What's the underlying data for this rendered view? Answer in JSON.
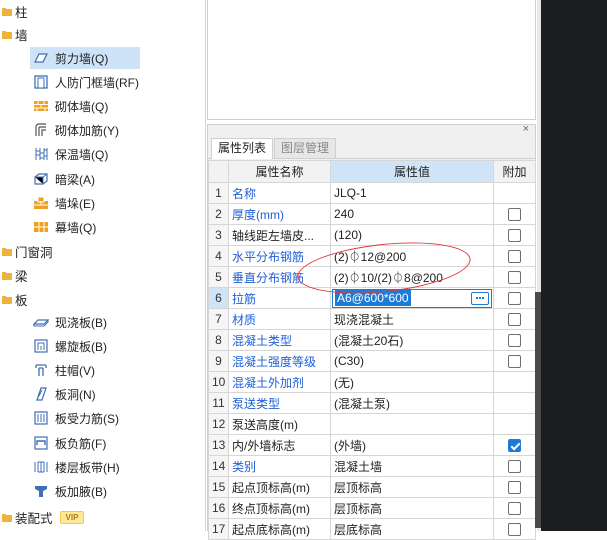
{
  "tree": {
    "categories": [
      {
        "label": "柱",
        "icon": "column-icon"
      },
      {
        "label": "墙",
        "icon": "wall-icon"
      },
      {
        "label": "门窗洞",
        "icon": "door-window-icon"
      },
      {
        "label": "梁",
        "icon": "beam-icon"
      },
      {
        "label": "板",
        "icon": "slab-icon"
      },
      {
        "label": "装配式",
        "icon": "prefab-icon",
        "badge": "VIP"
      }
    ],
    "wall_items": [
      {
        "label": "剪力墙(Q)",
        "icon": "shear-wall-icon",
        "selected": true
      },
      {
        "label": "人防门框墙(RF)",
        "icon": "civil-defense-door-wall-icon"
      },
      {
        "label": "砌体墙(Q)",
        "icon": "masonry-wall-icon"
      },
      {
        "label": "砌体加筋(Y)",
        "icon": "masonry-rebar-icon"
      },
      {
        "label": "保温墙(Q)",
        "icon": "insulation-wall-icon"
      },
      {
        "label": "暗梁(A)",
        "icon": "hidden-beam-icon"
      },
      {
        "label": "墙垛(E)",
        "icon": "wall-pier-icon"
      },
      {
        "label": "幕墙(Q)",
        "icon": "curtain-wall-icon"
      }
    ],
    "slab_items": [
      {
        "label": "现浇板(B)",
        "icon": "cast-slab-icon"
      },
      {
        "label": "螺旋板(B)",
        "icon": "spiral-slab-icon"
      },
      {
        "label": "柱帽(V)",
        "icon": "column-cap-icon"
      },
      {
        "label": "板洞(N)",
        "icon": "slab-hole-icon"
      },
      {
        "label": "板受力筋(S)",
        "icon": "slab-main-rebar-icon"
      },
      {
        "label": "板负筋(F)",
        "icon": "slab-negative-rebar-icon"
      },
      {
        "label": "楼层板带(H)",
        "icon": "floor-strip-icon"
      },
      {
        "label": "板加腋(B)",
        "icon": "slab-haunch-icon"
      }
    ]
  },
  "panel": {
    "close_glyph": "×",
    "tabs": [
      {
        "label": "属性列表",
        "active": true
      },
      {
        "label": "图层管理",
        "active": false
      }
    ],
    "headers": {
      "num": "",
      "name": "属性名称",
      "value": "属性值",
      "add": "附加"
    },
    "selected_row": 6,
    "rows": [
      {
        "num": "1",
        "name": "名称",
        "value": "JLQ-1",
        "blue": true,
        "checkbox": false
      },
      {
        "num": "2",
        "name": "厚度(mm)",
        "value": "240",
        "blue": true,
        "checkbox": true,
        "checked": false
      },
      {
        "num": "3",
        "name": "轴线距左墙皮...",
        "value": "(120)",
        "blue": false,
        "checkbox": true,
        "checked": false
      },
      {
        "num": "4",
        "name": "水平分布钢筋",
        "value": "(2)⏀12@200",
        "blue": true,
        "checkbox": true,
        "checked": false
      },
      {
        "num": "5",
        "name": "垂直分布钢筋",
        "value": "(2)⏀10/(2)⏀8@200",
        "blue": true,
        "checkbox": true,
        "checked": false
      },
      {
        "num": "6",
        "name": "拉筋",
        "value": "A6@600*600",
        "blue": true,
        "checkbox": true,
        "checked": false,
        "editing": true
      },
      {
        "num": "7",
        "name": "材质",
        "value": "现浇混凝土",
        "blue": true,
        "checkbox": true,
        "checked": false
      },
      {
        "num": "8",
        "name": "混凝土类型",
        "value": "(混凝土20石)",
        "blue": true,
        "checkbox": true,
        "checked": false
      },
      {
        "num": "9",
        "name": "混凝土强度等级",
        "value": "(C30)",
        "blue": true,
        "checkbox": true,
        "checked": false
      },
      {
        "num": "10",
        "name": "混凝土外加剂",
        "value": "(无)",
        "blue": true,
        "checkbox": false
      },
      {
        "num": "11",
        "name": "泵送类型",
        "value": "(混凝土泵)",
        "blue": true,
        "checkbox": false
      },
      {
        "num": "12",
        "name": "泵送高度(m)",
        "value": "",
        "blue": false,
        "checkbox": false
      },
      {
        "num": "13",
        "name": "内/外墙标志",
        "value": "(外墙)",
        "blue": false,
        "checkbox": true,
        "checked": true
      },
      {
        "num": "14",
        "name": "类别",
        "value": "混凝土墙",
        "blue": true,
        "checkbox": true,
        "checked": false
      },
      {
        "num": "15",
        "name": "起点顶标高(m)",
        "value": "层顶标高",
        "blue": false,
        "checkbox": true,
        "checked": false
      },
      {
        "num": "16",
        "name": "终点顶标高(m)",
        "value": "层顶标高",
        "blue": false,
        "checkbox": true,
        "checked": false
      },
      {
        "num": "17",
        "name": "起点底标高(m)",
        "value": "层底标高",
        "blue": false,
        "checkbox": true,
        "checked": false
      }
    ]
  }
}
